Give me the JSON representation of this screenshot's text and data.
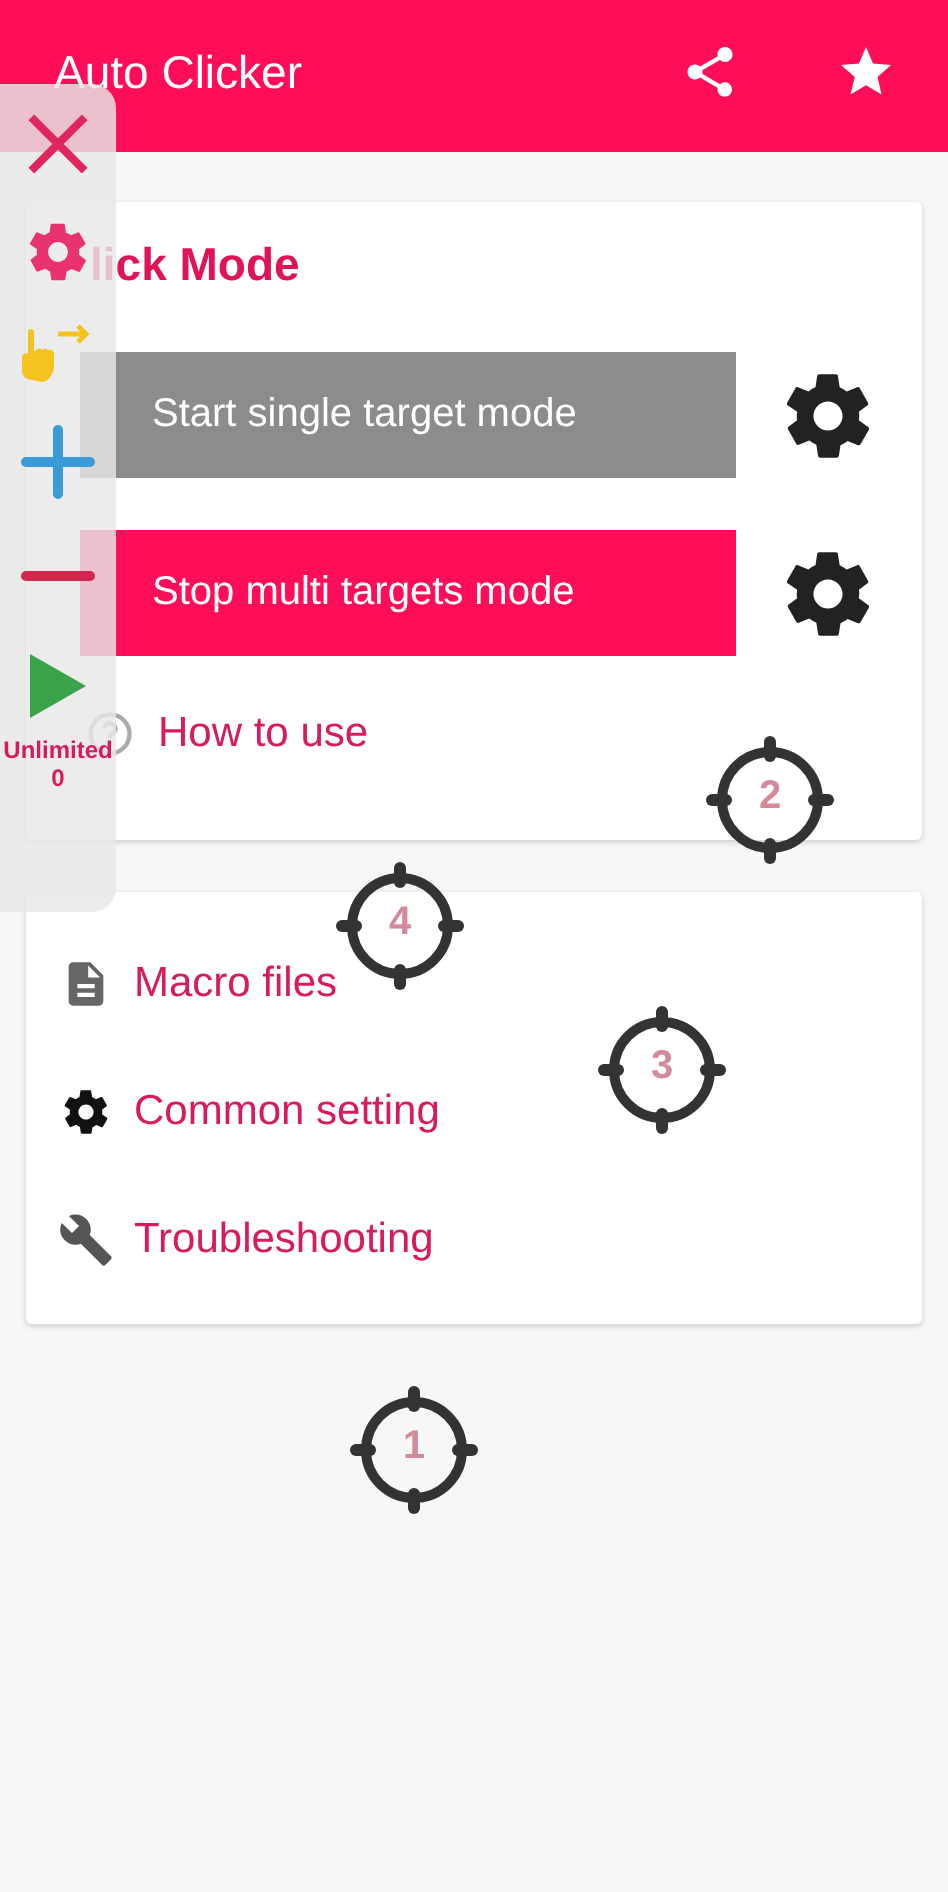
{
  "app_bar": {
    "title": "Auto Clicker"
  },
  "mode_card": {
    "heading": "lick Mode",
    "buttons": [
      {
        "label": "Start single target mode",
        "active": false
      },
      {
        "label": "Stop multi targets mode",
        "active": true
      }
    ],
    "help_link": "How to use"
  },
  "menu": [
    {
      "kind": "files",
      "label": "Macro files"
    },
    {
      "kind": "settings",
      "label": "Common setting"
    },
    {
      "kind": "wrench",
      "label": "Troubleshooting"
    }
  ],
  "control_panel": {
    "repeat_label": "Unlimited",
    "count": "0"
  },
  "targets": [
    {
      "number": "1"
    },
    {
      "number": "2"
    },
    {
      "number": "3"
    },
    {
      "number": "4"
    }
  ]
}
